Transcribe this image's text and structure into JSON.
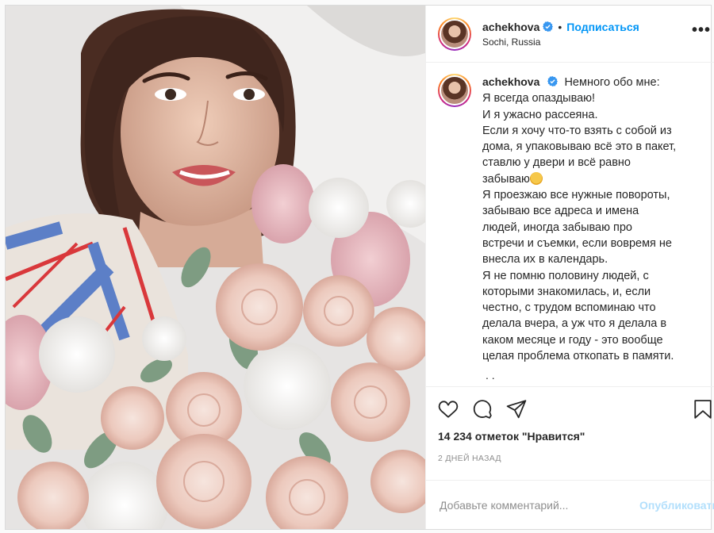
{
  "post": {
    "username": "achekhova",
    "verified": true,
    "follow_label": "Подписаться",
    "location": "Sochi, Russia",
    "more_icon": "more-dots-icon",
    "caption_lines": [
      "Немного обо мне:",
      "Я всегда опаздываю!",
      "И я ужасно рассеяна.",
      "Если я хочу что-то взять с собой из",
      "дома, я упаковываю всё это в пакет,",
      "ставлю у двери и всё равно",
      "забываю",
      "Я проезжаю все нужные повороты,",
      "забываю все адреса и имена",
      "людей, иногда забываю про",
      "встречи и съемки, если вовремя не",
      "внесла их в календарь.",
      "Я не помню половину людей, с",
      "которыми знакомилась, и, если",
      "честно, с трудом вспоминаю что",
      "делала вчера, а уж что я делала в",
      "каком месяце и году - это вообще",
      "целая проблема откопать в памяти."
    ],
    "caption_emoji": "screaming-face-emoji",
    "caption_more": ". .",
    "likes_text": "14 234 отметок \"Нравится\"",
    "time_text": "2 ДНЕЙ НАЗАД",
    "comment_placeholder": "Добавьте комментарий...",
    "publish_label": "Опубликовать",
    "icons": {
      "like": "heart-icon",
      "comment": "comment-bubble-icon",
      "share": "paper-plane-icon",
      "save": "bookmark-icon"
    }
  },
  "colors": {
    "link_blue": "#0095f6",
    "publish_disabled": "#b2dffc",
    "verified_blue": "#3897f0"
  }
}
